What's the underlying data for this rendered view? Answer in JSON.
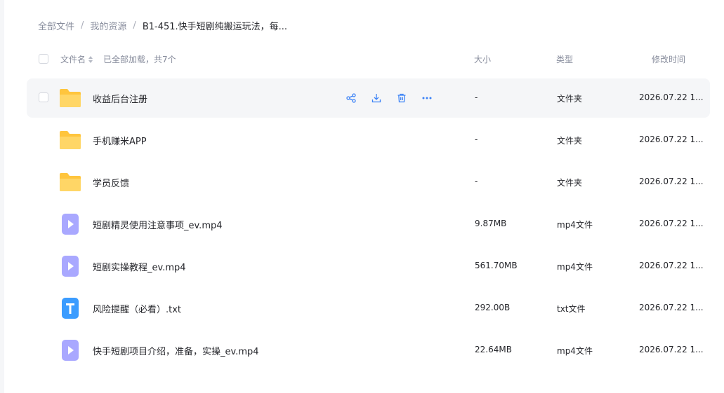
{
  "breadcrumb": {
    "items": [
      "全部文件",
      "我的资源"
    ],
    "separator": "/",
    "current": "B1-451.快手短剧纯搬运玩法，每..."
  },
  "header": {
    "name_label": "文件名",
    "loaded_text": "已全部加载，共7个",
    "size_label": "大小",
    "type_label": "类型",
    "time_label": "修改时间"
  },
  "colors": {
    "folder": "#ffc53d",
    "video": "#a9a8ff",
    "text": "#3b9cff",
    "action": "#3b82f6"
  },
  "rows": [
    {
      "name": "收益后台注册",
      "size": "-",
      "type": "文件夹",
      "time": "2026.07.22 1...",
      "icon": "folder-icon",
      "hovered": true
    },
    {
      "name": "手机赚米APP",
      "size": "-",
      "type": "文件夹",
      "time": "2026.07.22 1...",
      "icon": "folder-icon"
    },
    {
      "name": "学员反馈",
      "size": "-",
      "type": "文件夹",
      "time": "2026.07.22 1...",
      "icon": "folder-icon"
    },
    {
      "name": "短剧精灵使用注意事项_ev.mp4",
      "size": "9.87MB",
      "type": "mp4文件",
      "time": "2026.07.22 1...",
      "icon": "video-file-icon"
    },
    {
      "name": "短剧实操教程_ev.mp4",
      "size": "561.70MB",
      "type": "mp4文件",
      "time": "2026.07.22 1...",
      "icon": "video-file-icon"
    },
    {
      "name": "风险提醒（必看）.txt",
      "size": "292.00B",
      "type": "txt文件",
      "time": "2026.07.22 1...",
      "icon": "text-file-icon"
    },
    {
      "name": "快手短剧项目介绍，准备，实操_ev.mp4",
      "size": "22.64MB",
      "type": "mp4文件",
      "time": "2026.07.22 1...",
      "icon": "video-file-icon"
    }
  ],
  "row_actions": [
    "share-icon",
    "download-icon",
    "delete-icon",
    "more-icon"
  ]
}
